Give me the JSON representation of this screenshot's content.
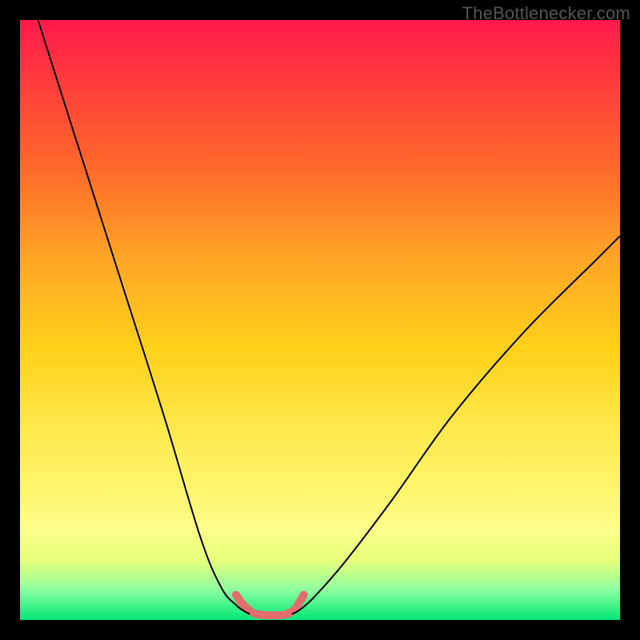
{
  "watermark": {
    "text": "TheBottlenecker.com"
  },
  "chart_data": {
    "type": "line",
    "title": "",
    "xlabel": "",
    "ylabel": "",
    "xlim": [
      0,
      100
    ],
    "ylim": [
      0,
      100
    ],
    "grid": false,
    "legend": false,
    "series": [
      {
        "name": "left-curve",
        "stroke": "#000000",
        "width": 2,
        "x": [
          3,
          10,
          17,
          24,
          30,
          33.5,
          36,
          37.5,
          38.3
        ],
        "y": [
          100,
          78,
          56,
          34,
          14,
          5.5,
          2.5,
          1.4,
          1.0
        ]
      },
      {
        "name": "right-curve",
        "stroke": "#000000",
        "width": 2,
        "x": [
          45.3,
          46.5,
          49,
          54,
          62,
          72,
          84,
          96,
          100
        ],
        "y": [
          1.0,
          1.6,
          3.8,
          9.5,
          20,
          34,
          48,
          60,
          64
        ]
      },
      {
        "name": "valley-highlight",
        "stroke": "#e26d6d",
        "width": 10,
        "linecap": "round",
        "x": [
          36.0,
          37.0,
          38.0,
          38.8,
          40.0,
          41.5,
          43.0,
          44.2,
          45.0,
          45.8,
          46.5,
          47.3
        ],
        "y": [
          4.2,
          2.8,
          1.8,
          1.2,
          0.9,
          0.8,
          0.8,
          0.9,
          1.2,
          1.8,
          2.8,
          4.2
        ]
      }
    ]
  }
}
